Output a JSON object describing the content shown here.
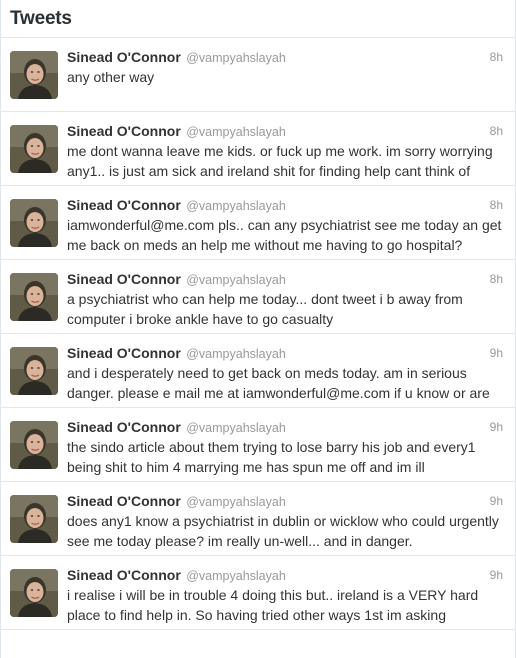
{
  "header": {
    "title": "Tweets"
  },
  "tweets": [
    {
      "fullname": "Sinead O'Connor",
      "username": "@vampyahslayah",
      "time": "8h",
      "text": "any other way"
    },
    {
      "fullname": "Sinead O'Connor",
      "username": "@vampyahslayah",
      "time": "8h",
      "text": "me dont wanna leave me kids. or fuck up me work. im sorry worrying any1.. is just am sick and ireland shit for finding help cant think of"
    },
    {
      "fullname": "Sinead O'Connor",
      "username": "@vampyahslayah",
      "time": "8h",
      "text": "iamwonderful@me.com pls.. can any psychiatrist see me today an get me back on meds an help me without me having to go hospital?"
    },
    {
      "fullname": "Sinead O'Connor",
      "username": "@vampyahslayah",
      "time": "8h",
      "text": "a psychiatrist who can help me today... dont tweet i b away from computer i broke ankle have to go casualty"
    },
    {
      "fullname": "Sinead O'Connor",
      "username": "@vampyahslayah",
      "time": "9h",
      "text": "and i desperately need to get back on meds today. am in serious danger. please e mail me at iamwonderful@me.com if u know or are"
    },
    {
      "fullname": "Sinead O'Connor",
      "username": "@vampyahslayah",
      "time": "9h",
      "text": "the sindo article about them trying to lose barry his job and every1 being shit to him 4 marrying me has spun me off and im ill"
    },
    {
      "fullname": "Sinead O'Connor",
      "username": "@vampyahslayah",
      "time": "9h",
      "text": "does any1 know a psychiatrist in dublin or wicklow who could urgently see me today please? im really un-well... and in danger."
    },
    {
      "fullname": "Sinead O'Connor",
      "username": "@vampyahslayah",
      "time": "9h",
      "text": "i realise i will be in trouble 4 doing this but.. ireland is a VERY hard place to find help in. So having tried other ways 1st im asking"
    }
  ]
}
